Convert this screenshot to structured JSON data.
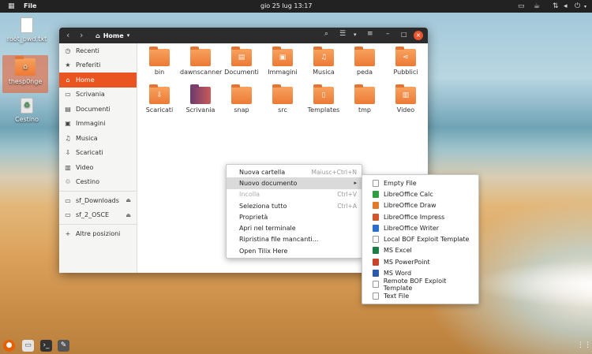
{
  "topbar": {
    "activities_icon": "grid-icon",
    "app_name": "File",
    "clock": "gio 25 lug  13:17"
  },
  "desktop": {
    "icons": [
      {
        "label": "root_pwd.txt"
      },
      {
        "label": "thesp0nge"
      },
      {
        "label": "Cestino"
      }
    ]
  },
  "window": {
    "location": "Home",
    "sidebar": {
      "items": [
        {
          "label": "Recenti",
          "icon": "clock-icon"
        },
        {
          "label": "Preferiti",
          "icon": "star-icon"
        },
        {
          "label": "Home",
          "icon": "home-icon"
        },
        {
          "label": "Scrivania",
          "icon": "desktop-icon"
        },
        {
          "label": "Documenti",
          "icon": "document-icon"
        },
        {
          "label": "Immagini",
          "icon": "image-icon"
        },
        {
          "label": "Musica",
          "icon": "music-icon"
        },
        {
          "label": "Scaricati",
          "icon": "download-icon"
        },
        {
          "label": "Video",
          "icon": "video-icon"
        },
        {
          "label": "Cestino",
          "icon": "trash-icon"
        },
        {
          "label": "sf_Downloads",
          "icon": "drive-icon"
        },
        {
          "label": "sf_2_OSCE",
          "icon": "drive-icon"
        },
        {
          "label": "Altre posizioni",
          "icon": "plus-icon"
        }
      ]
    },
    "files": [
      {
        "label": "bin"
      },
      {
        "label": "dawnscanner"
      },
      {
        "label": "Documenti"
      },
      {
        "label": "Immagini"
      },
      {
        "label": "Musica"
      },
      {
        "label": "peda"
      },
      {
        "label": "Pubblici"
      },
      {
        "label": "Scaricati"
      },
      {
        "label": "Scrivania"
      },
      {
        "label": "snap"
      },
      {
        "label": "src"
      },
      {
        "label": "Templates"
      },
      {
        "label": "tmp"
      },
      {
        "label": "Video"
      }
    ]
  },
  "context_menu": {
    "items": [
      {
        "label": "Nuova cartella",
        "shortcut": "Maiusc+Ctrl+N"
      },
      {
        "label": "Nuovo documento",
        "arrow": "▸"
      },
      {
        "label": "Incolla",
        "shortcut": "Ctrl+V"
      },
      {
        "label": "Seleziona tutto",
        "shortcut": "Ctrl+A"
      },
      {
        "label": "Proprietà"
      },
      {
        "label": "Apri nel terminale"
      },
      {
        "label": "Ripristina file mancanti..."
      },
      {
        "label": "Open Tilix Here"
      }
    ]
  },
  "submenu": {
    "items": [
      {
        "label": "Empty File",
        "color": "#ffffff"
      },
      {
        "label": "LibreOffice Calc",
        "color": "#2e9e43"
      },
      {
        "label": "LibreOffice Draw",
        "color": "#e07b2a"
      },
      {
        "label": "LibreOffice Impress",
        "color": "#d2562b"
      },
      {
        "label": "LibreOffice Writer",
        "color": "#2a6fc9"
      },
      {
        "label": "Local BOF Exploit Template",
        "color": "#ffffff"
      },
      {
        "label": "MS Excel",
        "color": "#1e7d45"
      },
      {
        "label": "MS PowerPoint",
        "color": "#c9442a"
      },
      {
        "label": "MS Word",
        "color": "#2b5aaa"
      },
      {
        "label": "Remote BOF Exploit Template",
        "color": "#ffffff"
      },
      {
        "label": "Text File",
        "color": "#ffffff"
      }
    ]
  },
  "colors": {
    "accent": "#e95420",
    "titlebar": "#2c2c2c",
    "folder": "#ec7a36"
  }
}
